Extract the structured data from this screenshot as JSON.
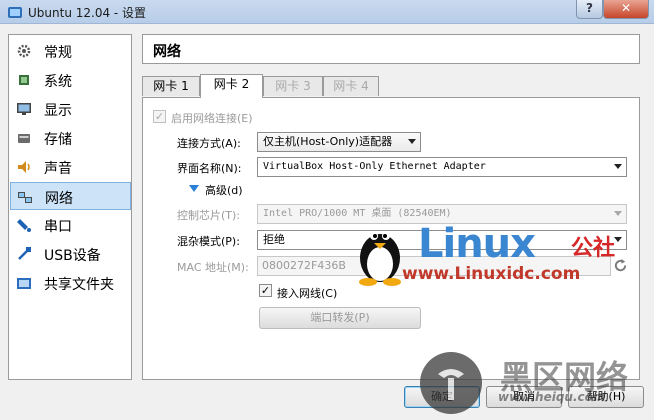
{
  "window": {
    "title": "Ubuntu 12.04 - 设置",
    "help_label": "?",
    "close_label": "✕"
  },
  "sidebar": {
    "items": [
      {
        "label": "常规",
        "icon": "gear-icon"
      },
      {
        "label": "系统",
        "icon": "chip-icon"
      },
      {
        "label": "显示",
        "icon": "monitor-icon"
      },
      {
        "label": "存储",
        "icon": "disk-icon"
      },
      {
        "label": "声音",
        "icon": "speaker-icon"
      },
      {
        "label": "网络",
        "icon": "network-icon"
      },
      {
        "label": "串口",
        "icon": "serial-port-icon"
      },
      {
        "label": "USB设备",
        "icon": "usb-icon"
      },
      {
        "label": "共享文件夹",
        "icon": "folder-icon"
      }
    ],
    "selected_index": 5
  },
  "header": {
    "title": "网络"
  },
  "tabs": [
    {
      "label": "网卡 1"
    },
    {
      "label": "网卡 2"
    },
    {
      "label": "网卡 3"
    },
    {
      "label": "网卡 4"
    }
  ],
  "form": {
    "enable_label": "启用网络连接(E)",
    "attached_label": "连接方式(A):",
    "attached_value": "仅主机(Host-Only)适配器",
    "name_label": "界面名称(N):",
    "name_value": "VirtualBox Host-Only Ethernet Adapter",
    "advanced_label": "高级(d)",
    "adapter_type_label": "控制芯片(T):",
    "adapter_type_value": "Intel PRO/1000 MT 桌面 (82540EM)",
    "promisc_label": "混杂模式(P):",
    "promisc_value": "拒绝",
    "mac_label": "MAC 地址(M):",
    "mac_value": "0800272F436B",
    "cable_label": "接入网线(C)",
    "port_forward_label": "端口转发(P)"
  },
  "footer": {
    "ok_label": "确定",
    "cancel_label": "取消",
    "help_label": "帮助(H)"
  },
  "watermarks": {
    "linux_title": "Linux",
    "linux_cn": "公社",
    "linux_url": "www.Linuxidc.com",
    "hq_title": "黑区网络",
    "hq_url": "www.heiqu.com"
  },
  "colors": {
    "accent": "#2a7fd6",
    "selection_bg": "#cde3f7",
    "close_button": "#c6452a"
  }
}
